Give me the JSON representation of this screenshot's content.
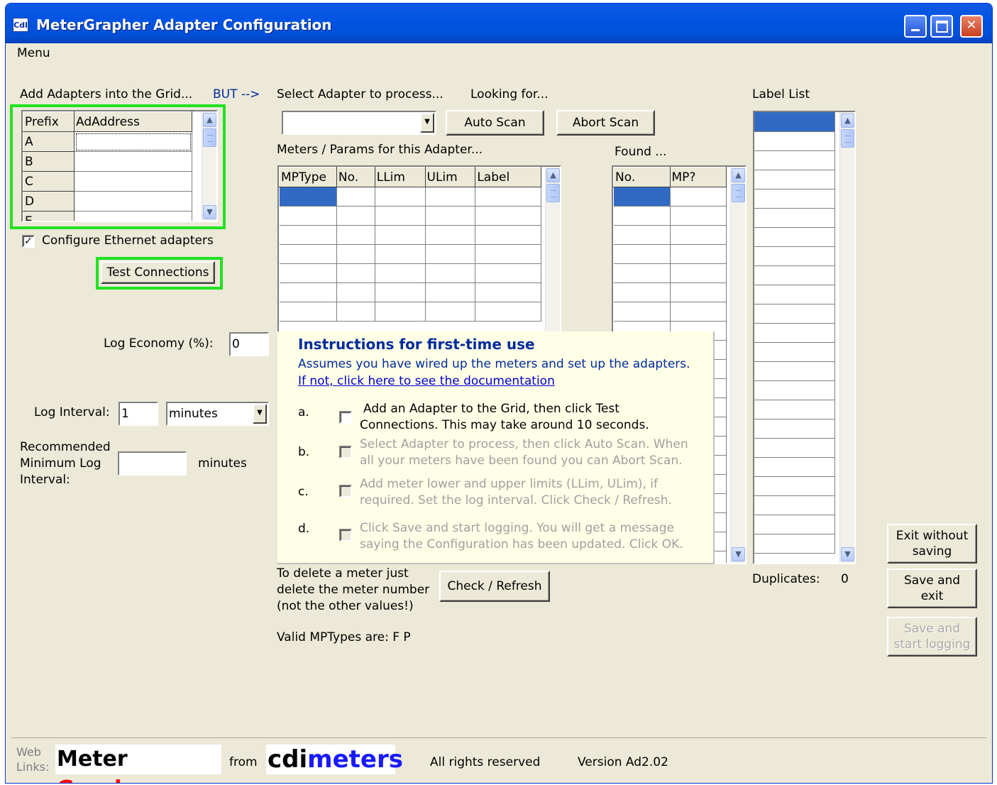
{
  "window": {
    "title": "MeterGrapher Adapter Configuration",
    "icon_text": "Cdl"
  },
  "menu": {
    "label": "Menu"
  },
  "adapters": {
    "heading": "Add Adapters into the Grid...",
    "but_arrow": "BUT -->",
    "columns": [
      "Prefix",
      "AdAddress"
    ],
    "rows": [
      {
        "prefix": "A",
        "address": ""
      },
      {
        "prefix": "B",
        "address": ""
      },
      {
        "prefix": "C",
        "address": ""
      },
      {
        "prefix": "D",
        "address": ""
      },
      {
        "prefix": "E",
        "address": ""
      }
    ],
    "ethernet_label": "Configure Ethernet adapters",
    "ethernet_checked": true,
    "test_button": "Test Connections"
  },
  "select_adapter": {
    "label": "Select Adapter to process...",
    "looking_for": "Looking for...",
    "value": "",
    "auto_scan": "Auto Scan",
    "abort_scan": "Abort Scan"
  },
  "meters": {
    "label": "Meters / Params for this Adapter...",
    "columns": [
      "MPType",
      "No.",
      "LLim",
      "ULim",
      "Label"
    ]
  },
  "found": {
    "label": "Found ...",
    "columns": [
      "No.",
      "MP?"
    ]
  },
  "label_list": {
    "label": "Label List",
    "duplicates_label": "Duplicates:",
    "duplicates_value": "0"
  },
  "log": {
    "economy_label": "Log Economy (%):",
    "economy_value": "0",
    "interval_label": "Log Interval:",
    "interval_value": "1",
    "interval_unit": "minutes",
    "recommended_label_1": "Recommended",
    "recommended_label_2": "Minimum Log",
    "recommended_label_3": "Interval:",
    "recommended_value": "",
    "recommended_unit": "minutes"
  },
  "instructions": {
    "title": "Instructions for first-time use",
    "subtitle": "Assumes you have wired up the meters and set up the adapters.",
    "link": "If not, click here to see the documentation",
    "steps": [
      {
        "letter": "a.",
        "line1": "Add an Adapter to the Grid, then click Test",
        "line2": "Connections.  This may take around 10 seconds."
      },
      {
        "letter": "b.",
        "line1": "Select Adapter to process, then click Auto Scan.  When",
        "line2": "all your meters have been found you can Abort Scan."
      },
      {
        "letter": "c.",
        "line1": "Add meter lower and upper limits (LLim, ULim), if",
        "line2": "required.  Set the log interval.  Click Check / Refresh."
      },
      {
        "letter": "d.",
        "line1": "Click Save and start logging.  You will get a message",
        "line2": "saying the Configuration has been updated.  Click OK."
      }
    ]
  },
  "delete_note": {
    "line1": "To delete a meter just",
    "line2": "delete the meter number",
    "line3": "(not the other values!)"
  },
  "check_refresh": "Check / Refresh",
  "valid_types": "Valid MPTypes are:  F  P",
  "actions": {
    "exit_without_saving_1": "Exit without",
    "exit_without_saving_2": "saving",
    "save_exit_1": "Save and",
    "save_exit_2": "exit",
    "save_start_1": "Save and",
    "save_start_2": "start logging"
  },
  "footer": {
    "web": "Web",
    "links": "Links:",
    "logo_meter": "Meter",
    "logo_grapher": "Grapher",
    "from": "from",
    "logo_cdi": "cdi",
    "logo_meters": "meters",
    "rights": "All rights reserved",
    "version": "Version Ad2.02"
  },
  "colors": {
    "selection": "#316ac5",
    "highlight_border": "#22e022",
    "brand_red": "#ff0000",
    "brand_blue": "#1a1aff"
  }
}
